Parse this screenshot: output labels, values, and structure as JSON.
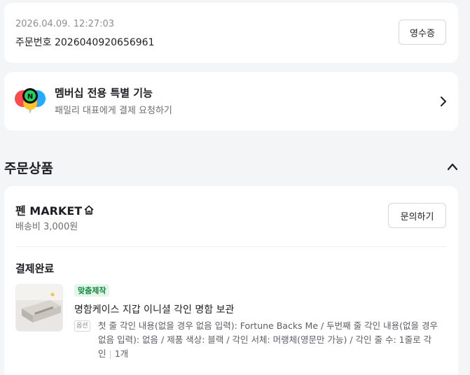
{
  "order": {
    "datetime": "2026.04.09. 12:27:03",
    "order_number_label": "주문번호 2026040920656961",
    "receipt_button": "영수증"
  },
  "membership": {
    "title": "멤버십 전용 특별 기능",
    "subtitle": "패밀리 대표에게 결제 요청하기"
  },
  "products_section": {
    "title": "주문상품"
  },
  "seller": {
    "name": "펜 MARKET",
    "shipping_fee": "배송비 3,000원",
    "inquiry_button": "문의하기"
  },
  "order_item": {
    "status": "결제완료",
    "badge": "맞춤제작",
    "name": "명함케이스 지갑 이니셜 각인 명함 보관",
    "option_badge": "옵션",
    "option_text": "첫 줄 각인 내용(없을 경우 없음 입력): Fortune Backs Me / 두번째 줄 각인 내용(없을 경우 없음 입력): 없음 / 제품 색상: 블랙 / 각인 서체: 머랭체(영문만 가능) / 각인 줄 수: 1줄로 각인",
    "quantity": "1개"
  },
  "colors": {
    "background": "#f4f5f7",
    "badge_green": "#0a8a3a",
    "badge_green_bg": "#e4f6e9"
  }
}
